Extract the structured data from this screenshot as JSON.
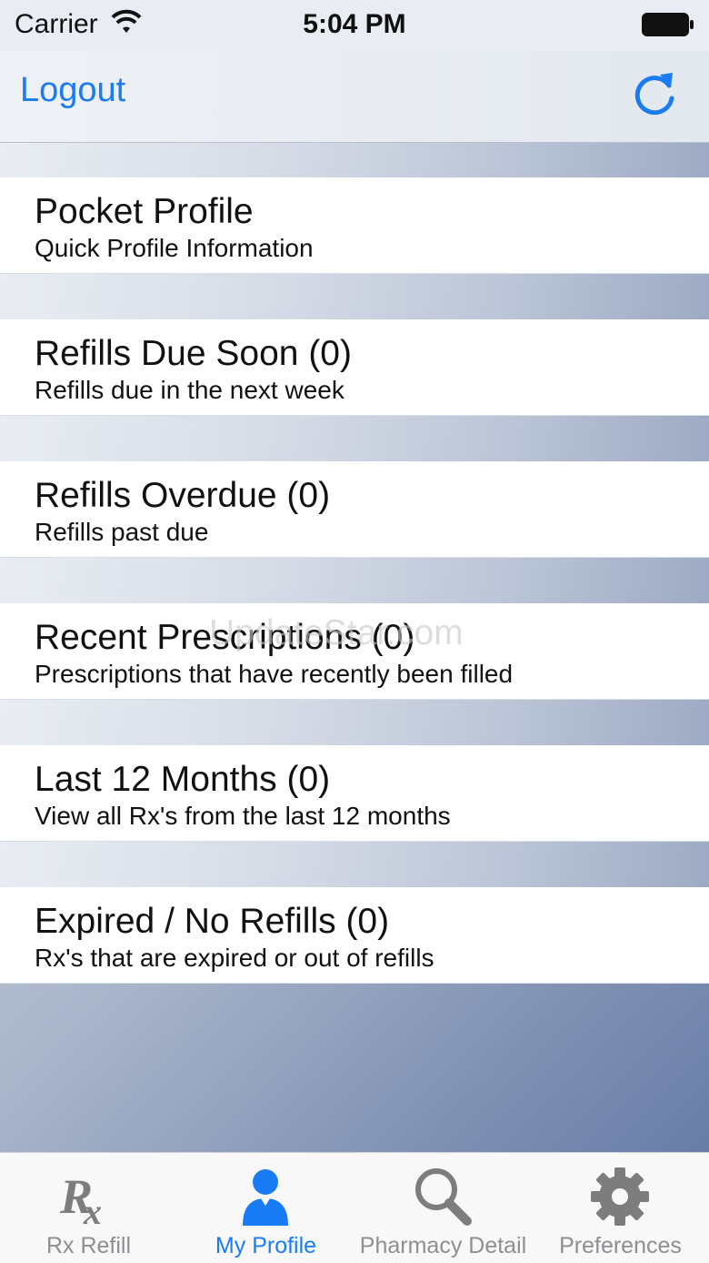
{
  "status_bar": {
    "carrier": "Carrier",
    "time": "5:04 PM"
  },
  "nav": {
    "logout_label": "Logout"
  },
  "menu": [
    {
      "title": "Pocket Profile",
      "subtitle": "Quick Profile Information"
    },
    {
      "title": "Refills Due Soon (0)",
      "subtitle": "Refills due in the next week"
    },
    {
      "title": "Refills Overdue (0)",
      "subtitle": "Refills past due"
    },
    {
      "title": "Recent Prescriptions (0)",
      "subtitle": "Prescriptions that have recently been filled"
    },
    {
      "title": "Last 12 Months (0)",
      "subtitle": "View all Rx's from the last 12 months"
    },
    {
      "title": "Expired / No Refills (0)",
      "subtitle": "Rx's that are expired or out of refills"
    }
  ],
  "watermark": "UpdateStar.com",
  "tabs": [
    {
      "label": "Rx Refill",
      "icon": "rx-icon",
      "active": false
    },
    {
      "label": "My Profile",
      "icon": "profile-icon",
      "active": true
    },
    {
      "label": "Pharmacy Detail",
      "icon": "search-icon",
      "active": false
    },
    {
      "label": "Preferences",
      "icon": "gear-icon",
      "active": false
    }
  ],
  "colors": {
    "accent": "#1a7cf5",
    "inactive": "#8e8e93"
  }
}
